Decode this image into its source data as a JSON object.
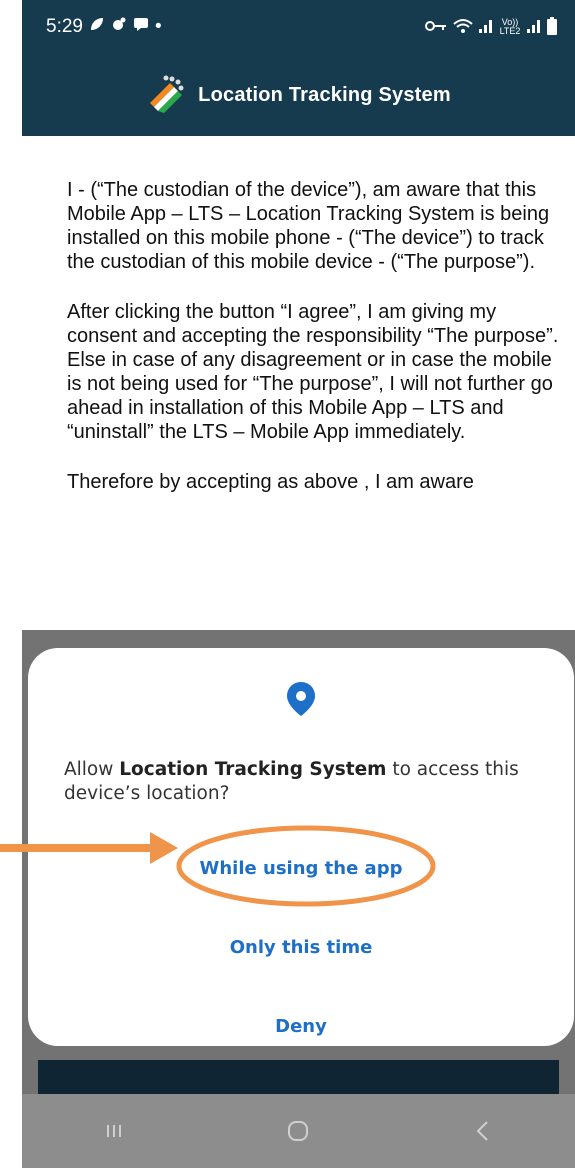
{
  "status_bar": {
    "time": "5:29",
    "dot": "•",
    "network_label": "Vo)) LTE2"
  },
  "app_bar": {
    "title": "Location Tracking System",
    "logo_icon": "lts-logo-icon"
  },
  "content": {
    "paragraphs": [
      "I - (“The custodian of the device”),  am aware that this Mobile App – LTS – Location Tracking System is being installed on this mobile phone - (“The device”) to track the custodian of this mobile device - (“The purpose”).",
      " After clicking the button  “I agree”, I am giving my consent and accepting the responsibility “The purpose”. Else in case of any disagreement or in case the mobile is not being used for “The purpose”, I will not further go ahead in installation of this Mobile App – LTS  and “uninstall” the LTS – Mobile App immediately.",
      " Therefore by accepting as above , I am aware"
    ]
  },
  "dialog": {
    "icon": "location-pin-icon",
    "msg_prefix": "Allow ",
    "msg_app": "Location Tracking System",
    "msg_suffix": " to access this device’s location?",
    "btn_while": "While using the app",
    "btn_once": "Only this time",
    "btn_deny": "Deny"
  },
  "colors": {
    "header": "#163a4e",
    "accent_blue": "#1d6fc7",
    "annotation_orange": "#f0944a"
  },
  "nav": [
    "recents-icon",
    "home-icon",
    "back-icon"
  ]
}
